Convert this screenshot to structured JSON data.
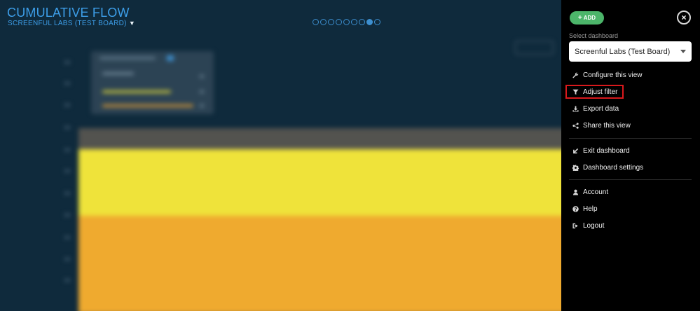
{
  "header": {
    "title": "CUMULATIVE FLOW",
    "subtitle": "SCREENFUL LABS (TEST BOARD)",
    "pager_dots": 9,
    "active_dot": 8
  },
  "colors": {
    "accent_blue": "#3d9ee8",
    "band_grey": "#53534f",
    "band_yellow": "#efe33a",
    "band_orange": "#efaa2f",
    "add_green": "#4cb56a",
    "highlight_red": "#d9191c"
  },
  "panel": {
    "add_label": "ADD",
    "select_label": "Select dashboard",
    "selected_dashboard": "Screenful Labs (Test Board)",
    "menu_groups": [
      [
        {
          "icon": "wrench-icon",
          "label": "Configure this view"
        },
        {
          "icon": "filter-icon",
          "label": "Adjust filter"
        },
        {
          "icon": "download-icon",
          "label": "Export data"
        },
        {
          "icon": "share-icon",
          "label": "Share this view"
        }
      ],
      [
        {
          "icon": "exit-icon",
          "label": "Exit dashboard"
        },
        {
          "icon": "gear-icon",
          "label": "Dashboard settings"
        }
      ],
      [
        {
          "icon": "user-icon",
          "label": "Account"
        },
        {
          "icon": "help-icon",
          "label": "Help"
        },
        {
          "icon": "logout-icon",
          "label": "Logout"
        }
      ]
    ]
  }
}
